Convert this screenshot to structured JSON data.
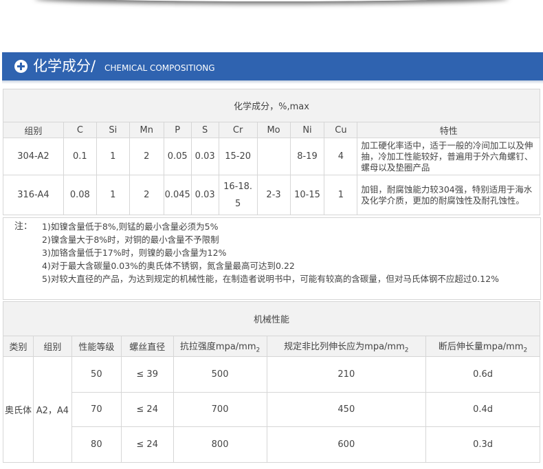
{
  "banner": {
    "title_cn": "化学成分/",
    "title_en": "CHEMICAL COMPOSITIONG"
  },
  "chemical": {
    "caption": "化学成分，%,max",
    "headers": [
      "组别",
      "C",
      "Si",
      "Mn",
      "P",
      "S",
      "Cr",
      "Mo",
      "Ni",
      "Cu",
      "特性"
    ],
    "rows": [
      {
        "group": "304-A2",
        "c": "0.1",
        "si": "1",
        "mn": "2",
        "p": "0.05",
        "s": "0.03",
        "cr": "15-20",
        "mo": "",
        "ni": "8-19",
        "cu": "4",
        "spec": "加工硬化率适中，适于一般的冷间加工以及伸抽，冷加工性能较好，普遍用于外六角螺钉、螺母以及垫圈产品"
      },
      {
        "group": "316-A4",
        "c": "0.08",
        "si": "1",
        "mn": "2",
        "p": "0.045",
        "s": "0.03",
        "cr": "16-18.5",
        "mo": "2-3",
        "ni": "10-15",
        "cu": "1",
        "spec": "加钼，耐腐蚀能力较304强，特别适用于海水及化学介质，更加的耐腐蚀性及耐孔蚀性。"
      }
    ]
  },
  "notes": {
    "label": "注：",
    "items": [
      "1)如镍含量低于8%,则锰的最小含量必须为5%",
      "2)镍含量大于8%时，对铜的最小含量不予限制",
      "3)加铬含量低于17%时，则镍的最小含量为12%",
      "4)对于最大含碳量0.03%的奥氏体不锈钢，氮含量最高可达到0.22",
      "5)对较大直径的产品，为达到规定的机械性能，在制造者说明书中，可能有较高的含碳量，但对马氏体钢不应超过0.12%"
    ]
  },
  "mechanical": {
    "caption": "机械性能",
    "headers": {
      "category": "类别",
      "group": "组别",
      "grade": "性能等级",
      "diameter": "螺丝直径",
      "tensile": "抗拉强度mpa/mm",
      "tensile_sub": "2",
      "yield": "规定非比列伸长应为mpa/mm",
      "yield_sub": "2",
      "elong": "断后伸长量mpa/mm",
      "elong_sub": "2"
    },
    "category": "奥氏体",
    "group": "A2，A4",
    "rows": [
      {
        "grade": "50",
        "diameter": "≤ 39",
        "tensile": "500",
        "yield": "210",
        "elong": "0.6d"
      },
      {
        "grade": "70",
        "diameter": "≤ 24",
        "tensile": "700",
        "yield": "450",
        "elong": "0.4d"
      },
      {
        "grade": "80",
        "diameter": "≤ 24",
        "tensile": "800",
        "yield": "600",
        "elong": "0.3d"
      }
    ]
  }
}
